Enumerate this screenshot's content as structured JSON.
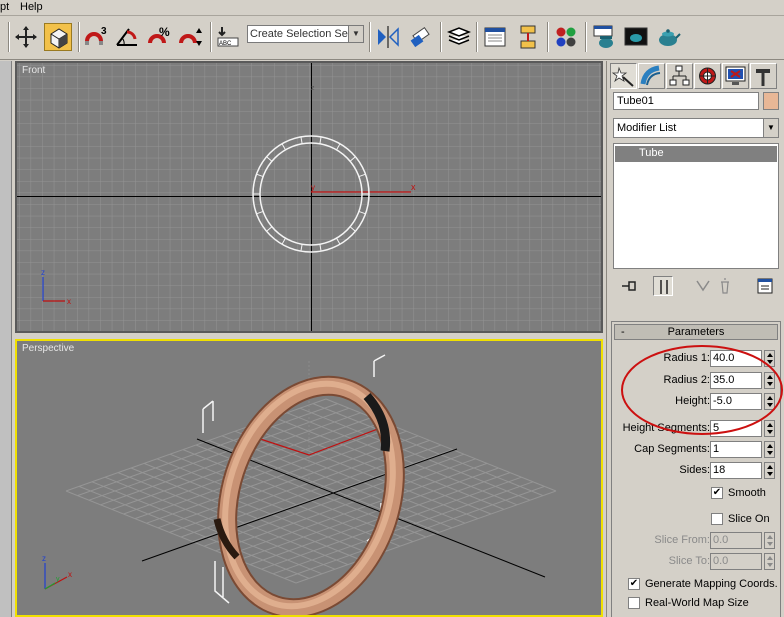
{
  "menubar": {
    "items": [
      "pt",
      "Help"
    ]
  },
  "toolbar": {
    "selection_set_placeholder": "Create Selection Set",
    "snap_label": "3",
    "percent_label": "%"
  },
  "viewports": {
    "front": {
      "label": "Front"
    },
    "perspective": {
      "label": "Perspective"
    }
  },
  "panel": {
    "object_name": "Tube01",
    "object_color": "#e8b796",
    "modifier_list": "Modifier List",
    "stack_items": [
      "Tube"
    ]
  },
  "parameters": {
    "title": "Parameters",
    "collapse_symbol": "-",
    "radius1": {
      "label": "Radius 1:",
      "value": "40.0"
    },
    "radius2": {
      "label": "Radius 2:",
      "value": "35.0"
    },
    "height": {
      "label": "Height:",
      "value": "-5.0"
    },
    "height_segments": {
      "label": "Height Segments:",
      "value": "5"
    },
    "cap_segments": {
      "label": "Cap Segments:",
      "value": "1"
    },
    "sides": {
      "label": "Sides:",
      "value": "18"
    },
    "smooth": {
      "label": "Smooth",
      "checked": true
    },
    "slice_on": {
      "label": "Slice On",
      "checked": false
    },
    "slice_from": {
      "label": "Slice From:",
      "value": "0.0"
    },
    "slice_to": {
      "label": "Slice To:",
      "value": "0.0"
    },
    "gen_mapping": {
      "label": "Generate Mapping Coords.",
      "checked": true
    },
    "real_world": {
      "label": "Real-World Map Size",
      "checked": false
    }
  },
  "colors": {
    "accent": "#f2c14a",
    "annotation": "#cc1010",
    "viewport_bg": "#7d7d7d",
    "tube": "#c89274",
    "active_viewport_border": "#f0e000"
  },
  "icons": [
    "select-move-icon",
    "select-object-icon",
    "snap-icon",
    "angle-snap-icon",
    "percent-snap-icon",
    "spinner-snap-icon",
    "edit-named-sets-icon",
    "mirror-icon",
    "align-icon",
    "layer-manager-icon",
    "curve-editor-icon",
    "schematic-view-icon",
    "material-editor-icon",
    "render-setup-icon",
    "render-frame-icon",
    "quick-render-icon"
  ]
}
